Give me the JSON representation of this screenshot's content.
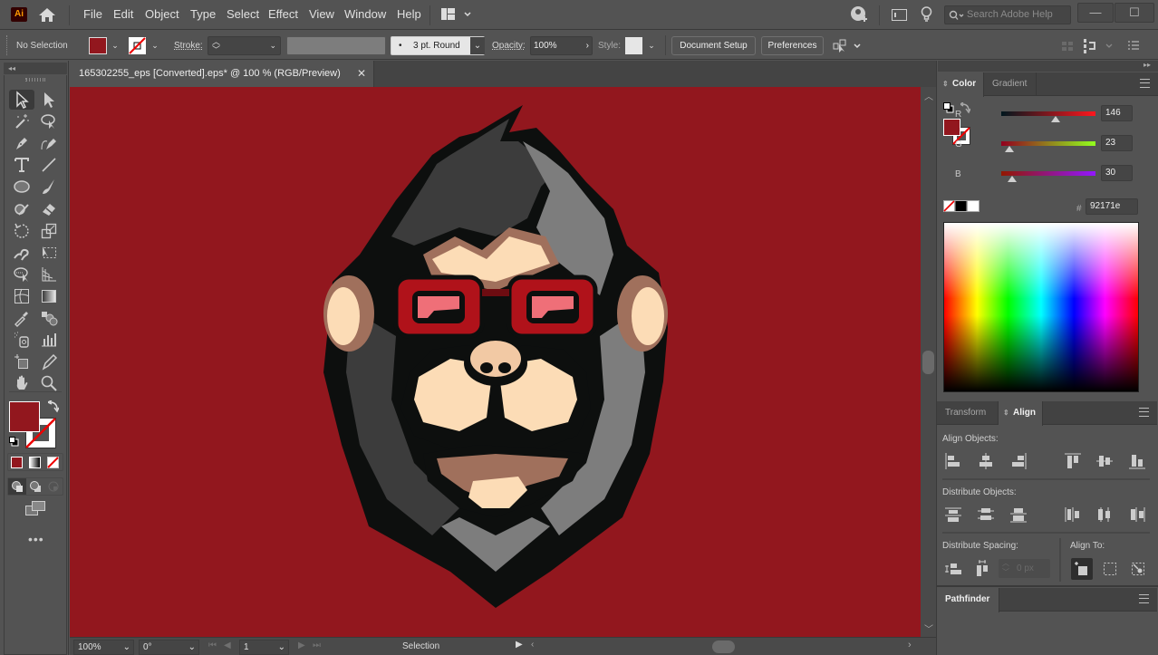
{
  "app": {
    "logo": "Ai",
    "name": "Adobe Illustrator"
  },
  "menu": [
    "File",
    "Edit",
    "Object",
    "Type",
    "Select",
    "Effect",
    "View",
    "Window",
    "Help"
  ],
  "search": {
    "placeholder": "Search Adobe Help"
  },
  "window_buttons": {
    "minimize": "—",
    "maximize": "☐",
    "close": "✕"
  },
  "control_bar": {
    "selection": "No Selection",
    "stroke_label": "Stroke:",
    "brush": "3 pt. Round",
    "opacity_label": "Opacity:",
    "opacity_value": "100%",
    "style_label": "Style:",
    "document_setup": "Document Setup",
    "preferences": "Preferences",
    "fill_color": "#92171e"
  },
  "document": {
    "tab_title": "165302255_eps [Converted].eps* @ 100 % (RGB/Preview)",
    "close": "✕",
    "artboard_color": "#92171e"
  },
  "status_bar": {
    "zoom": "100%",
    "rotation": "0°",
    "artboard": "1",
    "tool": "Selection"
  },
  "tools": [
    {
      "name": "selection-tool",
      "active": true
    },
    {
      "name": "direct-selection-tool"
    },
    {
      "name": "magic-wand-tool"
    },
    {
      "name": "lasso-tool"
    },
    {
      "name": "pen-tool"
    },
    {
      "name": "curvature-tool"
    },
    {
      "name": "type-tool",
      "glyph": "T"
    },
    {
      "name": "line-segment-tool"
    },
    {
      "name": "ellipse-tool"
    },
    {
      "name": "paintbrush-tool"
    },
    {
      "name": "shaper-tool"
    },
    {
      "name": "eraser-tool"
    },
    {
      "name": "rotate-tool"
    },
    {
      "name": "scale-tool"
    },
    {
      "name": "puppet-warp-tool"
    },
    {
      "name": "free-transform-tool"
    },
    {
      "name": "shape-builder-tool"
    },
    {
      "name": "perspective-grid-tool"
    },
    {
      "name": "mesh-tool"
    },
    {
      "name": "gradient-tool"
    },
    {
      "name": "eyedropper-tool"
    },
    {
      "name": "blend-tool"
    },
    {
      "name": "symbol-sprayer-tool"
    },
    {
      "name": "column-graph-tool"
    },
    {
      "name": "artboard-tool"
    },
    {
      "name": "slice-tool"
    },
    {
      "name": "hand-tool"
    },
    {
      "name": "zoom-tool"
    }
  ],
  "color_panel": {
    "tabs": [
      "Color",
      "Gradient"
    ],
    "active_tab": "Color",
    "channels": [
      {
        "label": "R",
        "value": "146",
        "fraction": 0.573
      },
      {
        "label": "G",
        "value": "23",
        "fraction": 0.09
      },
      {
        "label": "B",
        "value": "30",
        "fraction": 0.118
      }
    ],
    "hex_label": "#",
    "hex": "92171e",
    "fill": "#92171e"
  },
  "align_panel": {
    "tabs": [
      "Transform",
      "Align"
    ],
    "active_tab": "Align",
    "align_objects": "Align Objects:",
    "distribute_objects": "Distribute Objects:",
    "distribute_spacing": "Distribute Spacing:",
    "spacing_value": "0 px",
    "align_to": "Align To:"
  },
  "pathfinder_panel": {
    "title": "Pathfinder"
  }
}
